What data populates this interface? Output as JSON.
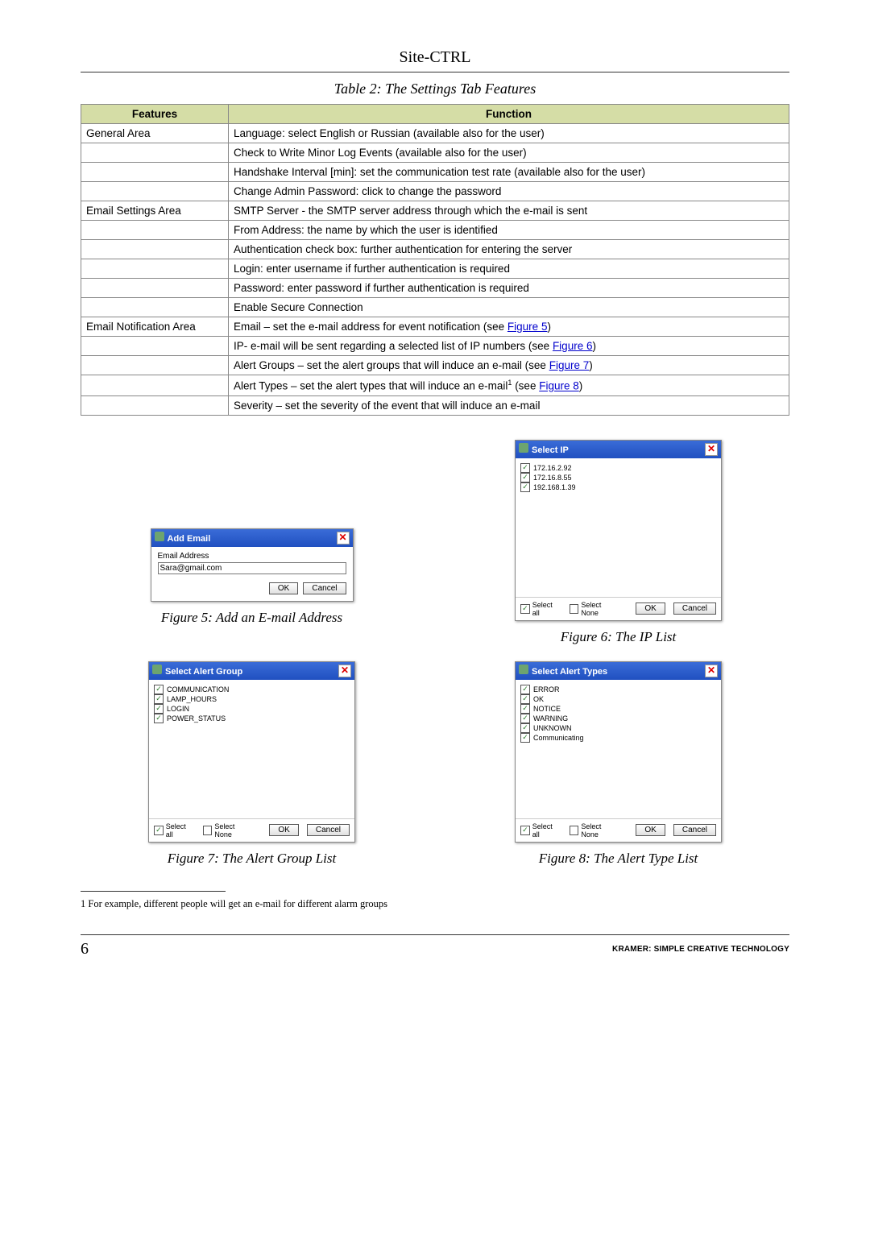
{
  "header": "Site-CTRL",
  "table_caption": "Table 2: The Settings Tab Features",
  "table": {
    "headers": {
      "c1": "Features",
      "c2": "Function"
    },
    "rows": [
      {
        "feature": "General Area",
        "func": "Language: select English or Russian (available also for the user)"
      },
      {
        "feature": "",
        "func": "Check to Write Minor Log Events (available also for the user)"
      },
      {
        "feature": "",
        "func": "Handshake Interval [min]: set the communication test rate (available also for the user)"
      },
      {
        "feature": "",
        "func": "Change Admin Password: click to change the password"
      },
      {
        "feature": "Email Settings Area",
        "func": "SMTP Server - the SMTP server address through which the e-mail is sent"
      },
      {
        "feature": "",
        "func": "From Address: the name by which the user is identified"
      },
      {
        "feature": "",
        "func": "Authentication check box: further authentication for entering the server"
      },
      {
        "feature": "",
        "func": "Login: enter username if further authentication is required"
      },
      {
        "feature": "",
        "func": "Password: enter password if further authentication is required"
      },
      {
        "feature": "",
        "func": "Enable Secure Connection"
      },
      {
        "feature": "Email Notification Area",
        "func_pre": "Email – set the e-mail address for event notification (see ",
        "link": "Figure 5",
        "func_post": ")"
      },
      {
        "feature": "",
        "func_pre": "IP- e-mail will be sent regarding a selected list of IP numbers (see ",
        "link": "Figure 6",
        "func_post": ")"
      },
      {
        "feature": "",
        "func_pre": "Alert Groups – set the alert groups that will induce an e-mail (see ",
        "link": "Figure 7",
        "func_post": ")"
      },
      {
        "feature": "",
        "func_pre": "Alert Types – set the alert types that will induce an e-mail",
        "sup": "1",
        "mid": " (see ",
        "link": "Figure 8",
        "func_post": ")"
      },
      {
        "feature": "",
        "func": "Severity – set the severity of the event that will induce an e-mail"
      }
    ]
  },
  "dialogs": {
    "add_email": {
      "title": "Add Email",
      "label": "Email Address",
      "value": "Sara@gmail.com",
      "ok": "OK",
      "cancel": "Cancel"
    },
    "select_ip": {
      "title": "Select IP",
      "items": [
        "172.16.2.92",
        "172.16.8.55",
        "192.168.1.39"
      ],
      "select_all": "Select all",
      "select_none": "Select None",
      "ok": "OK",
      "cancel": "Cancel"
    },
    "select_alert_group": {
      "title": "Select Alert Group",
      "items": [
        "COMMUNICATION",
        "LAMP_HOURS",
        "LOGIN",
        "POWER_STATUS"
      ],
      "select_all": "Select all",
      "select_none": "Select None",
      "ok": "OK",
      "cancel": "Cancel"
    },
    "select_alert_types": {
      "title": "Select Alert Types",
      "items": [
        "ERROR",
        "OK",
        "NOTICE",
        "WARNING",
        "UNKNOWN",
        "Communicating"
      ],
      "select_all": "Select all",
      "select_none": "Select None",
      "ok": "OK",
      "cancel": "Cancel"
    }
  },
  "captions": {
    "f5": "Figure 5: Add an E-mail Address",
    "f6": "Figure 6: The IP List",
    "f7": "Figure 7: The Alert Group List",
    "f8": "Figure 8: The Alert Type List"
  },
  "footnote": "1 For example, different people will get an e-mail for different alarm groups",
  "page_number": "6",
  "footer_brand": "KRAMER: SIMPLE CREATIVE TECHNOLOGY"
}
